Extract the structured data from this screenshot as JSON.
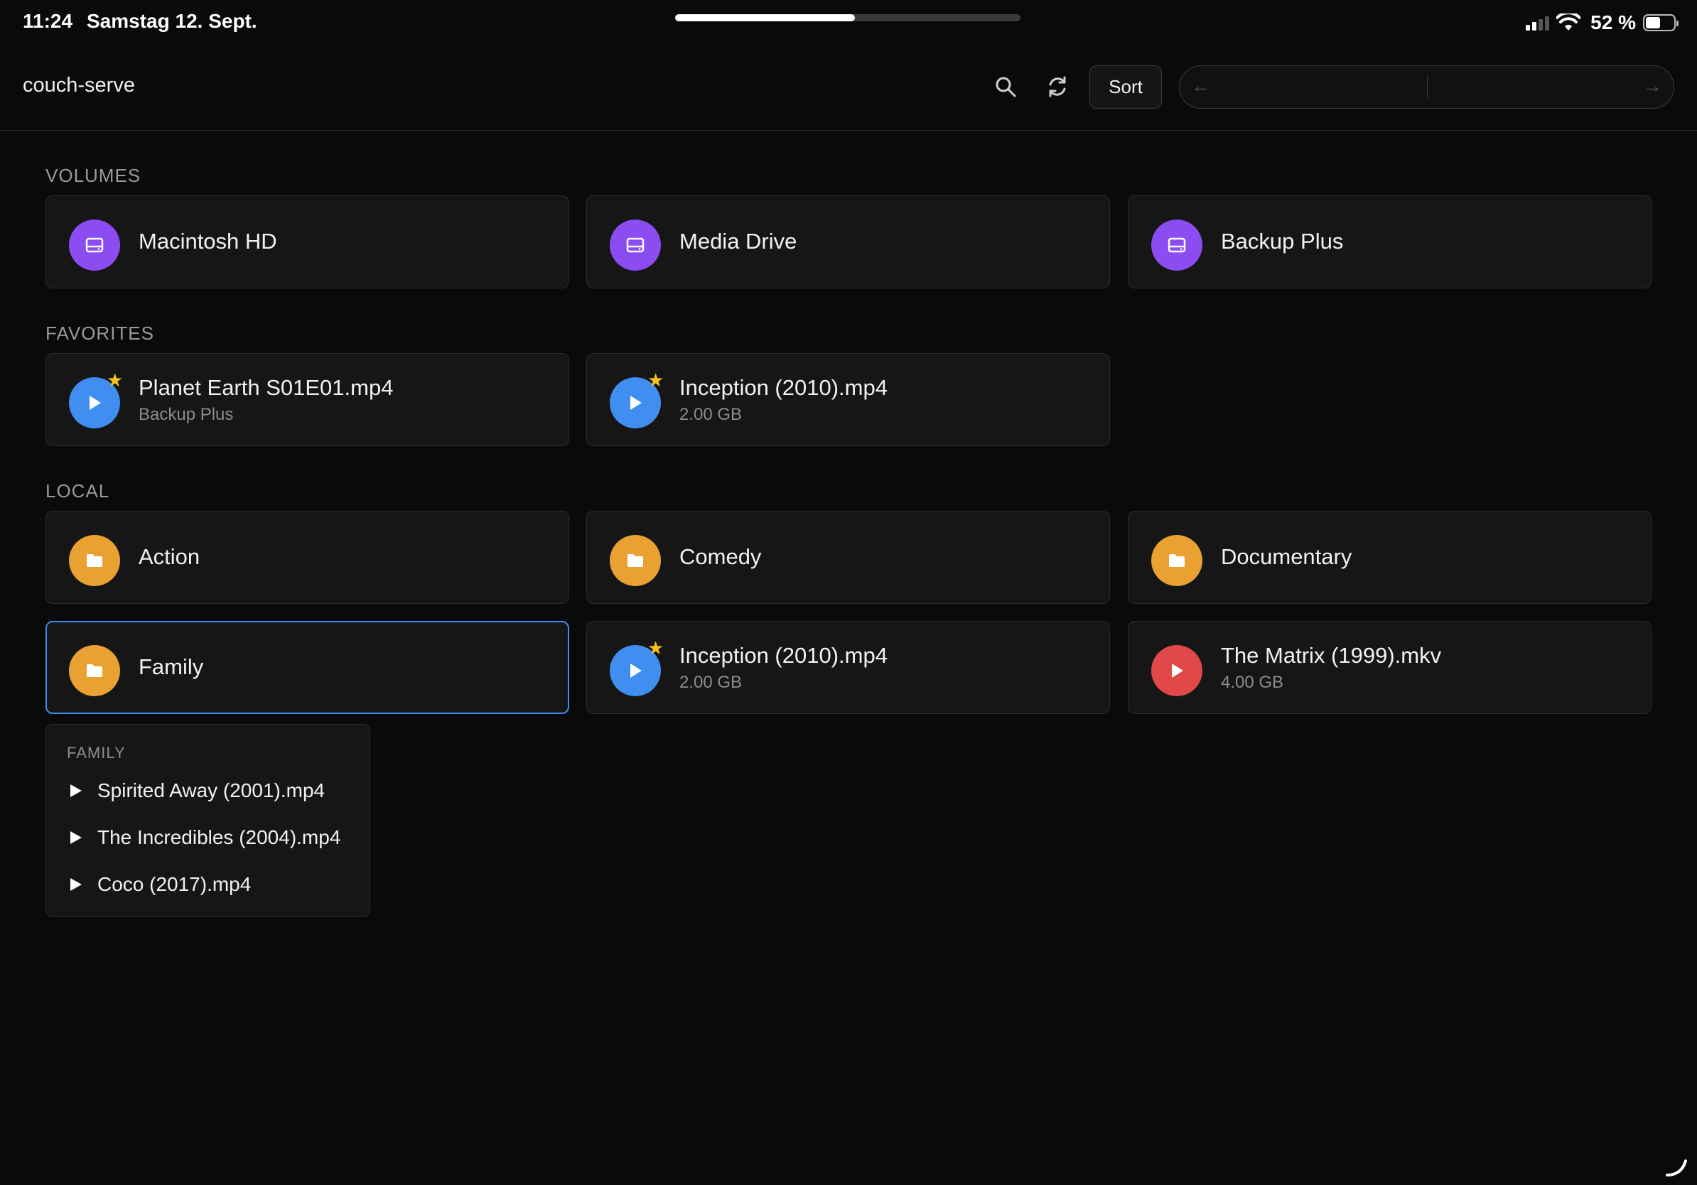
{
  "status_bar": {
    "time": "11:24",
    "date": "Samstag 12. Sept.",
    "battery_percent": "52 %",
    "battery_level": 0.52,
    "page_progress": 0.52,
    "icons": [
      "signal-icon",
      "wifi-icon",
      "battery-icon"
    ]
  },
  "toolbar": {
    "title": "couch-serve",
    "search_icon": "search-icon",
    "refresh_icon": "refresh-icon",
    "sort_label": "Sort",
    "back_arrow": "←",
    "forward_arrow": "→"
  },
  "sections": {
    "volumes": {
      "label": "VOLUMES",
      "items": [
        {
          "title": "Macintosh HD",
          "icon": "drive-icon",
          "color": "#8b4cf2"
        },
        {
          "title": "Media Drive",
          "icon": "drive-icon",
          "color": "#8b4cf2"
        },
        {
          "title": "Backup Plus",
          "icon": "drive-icon",
          "color": "#8b4cf2"
        }
      ]
    },
    "favorites": {
      "label": "FAVORITES",
      "items": [
        {
          "title": "Planet Earth S01E01.mp4",
          "subtitle": "Backup Plus",
          "icon": "play-icon",
          "color": "#3f8ef0",
          "starred": true
        },
        {
          "title": "Inception (2010).mp4",
          "subtitle": "2.00 GB",
          "icon": "play-icon",
          "color": "#3f8ef0",
          "starred": true
        }
      ]
    },
    "local": {
      "label": "LOCAL",
      "items": [
        {
          "title": "Action",
          "icon": "folder-icon",
          "color": "#e9a232"
        },
        {
          "title": "Comedy",
          "icon": "folder-icon",
          "color": "#e9a232"
        },
        {
          "title": "Documentary",
          "icon": "folder-icon",
          "color": "#e9a232"
        },
        {
          "title": "Family",
          "icon": "folder-icon",
          "color": "#e9a232",
          "selected": true
        },
        {
          "title": "Inception (2010).mp4",
          "subtitle": "2.00 GB",
          "icon": "play-icon",
          "color": "#3f8ef0",
          "starred": true
        },
        {
          "title": "The Matrix (1999).mkv",
          "subtitle": "4.00 GB",
          "icon": "play-icon",
          "color": "#e0484a"
        }
      ]
    }
  },
  "popover": {
    "header": "FAMILY",
    "items": [
      {
        "label": "Spirited Away (2001).mp4"
      },
      {
        "label": "The Incredibles (2004).mp4"
      },
      {
        "label": "Coco (2017).mp4"
      }
    ]
  },
  "accent_colors": {
    "selection": "#3a8ef0",
    "star": "#f7c21c"
  }
}
